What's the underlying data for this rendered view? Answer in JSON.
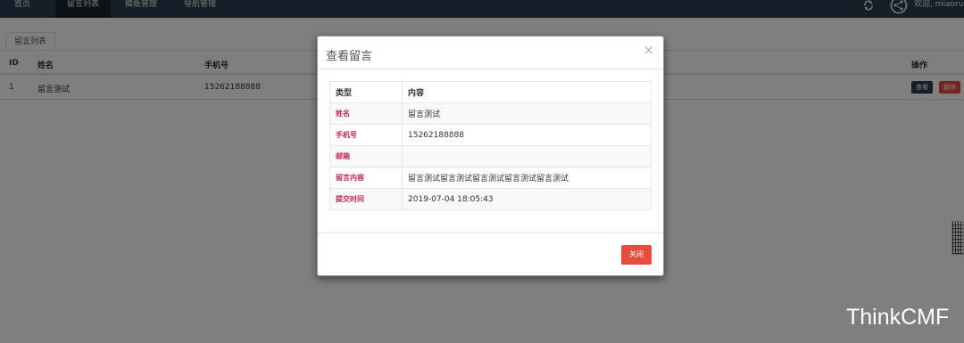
{
  "navbar": {
    "items": [
      {
        "label": "首页",
        "active": false
      },
      {
        "label": "留言列表",
        "active": true
      },
      {
        "label": "模板管理",
        "active": false
      },
      {
        "label": "导航管理",
        "active": false
      }
    ],
    "welcome": "欢迎, miaorun",
    "icons": [
      "refresh-icon",
      "user-avatar"
    ]
  },
  "page": {
    "tab_label": "留言列表",
    "table": {
      "headers": [
        "ID",
        "姓名",
        "手机号",
        "操作"
      ],
      "rows": [
        {
          "id": "1",
          "name": "留言测试",
          "phone": "15262188888",
          "actions": [
            "查看",
            "删除"
          ]
        }
      ]
    }
  },
  "brand": "ThinkCMF",
  "modal": {
    "title": "查看留言",
    "close_icon": "×",
    "headers": {
      "type": "类型",
      "content": "内容"
    },
    "fields": [
      {
        "label": "姓名",
        "value": "留言测试"
      },
      {
        "label": "手机号",
        "value": "15262188888"
      },
      {
        "label": "邮箱",
        "value": ""
      },
      {
        "label": "留言内容",
        "value": "留言测试留言测试留言测试留言测试留言测试"
      },
      {
        "label": "提交时间",
        "value": "2019-07-04 18:05:43"
      }
    ],
    "close_button": "关闭"
  },
  "colors": {
    "navbar_bg": "#2c3e50",
    "danger": "#e74c3c",
    "primary_dark": "#2c3e50",
    "label_red": "#c7254e"
  }
}
